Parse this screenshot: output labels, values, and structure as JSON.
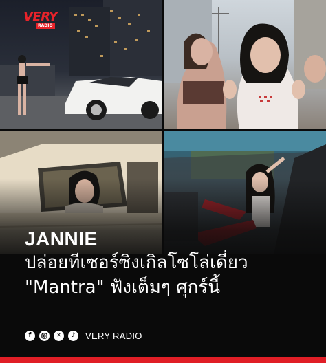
{
  "logo": {
    "text": "VERY",
    "sub": "RADIO"
  },
  "photos": [
    {
      "name": "rooftop-car-scene"
    },
    {
      "name": "dancers-street-scene"
    },
    {
      "name": "vintage-car-scene"
    },
    {
      "name": "convertible-scene"
    }
  ],
  "headline": {
    "name": "JANNIE",
    "line1": "ปล่อยทีเซอร์ซิงเกิลโซโล่เดี่ยว",
    "line2": "\"Mantra\" ฟังเต็มๆ ศุกร์นี้"
  },
  "footer": {
    "icons": [
      "facebook-icon",
      "instagram-icon",
      "x-icon",
      "tiktok-icon"
    ],
    "brand": "VERY RADIO"
  },
  "colors": {
    "accent": "#e01e26",
    "background": "#0a0a0a"
  }
}
